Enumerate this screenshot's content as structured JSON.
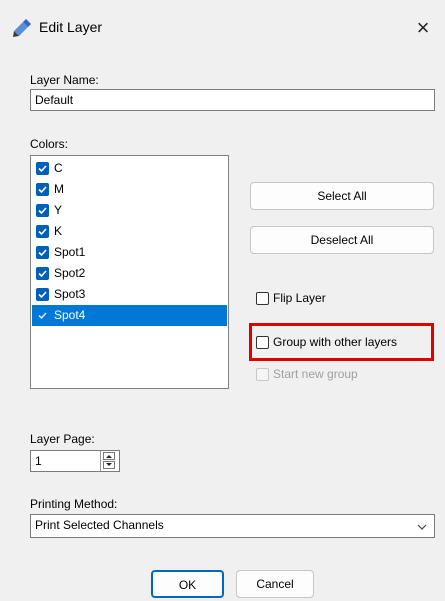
{
  "window": {
    "title": "Edit Layer",
    "close_label": "×",
    "icon": "edit-pencil-icon"
  },
  "layer_name": {
    "label": "Layer Name:",
    "value": "Default"
  },
  "colors": {
    "label": "Colors:",
    "items": [
      {
        "label": "C",
        "checked": true,
        "selected": false
      },
      {
        "label": "M",
        "checked": true,
        "selected": false
      },
      {
        "label": "Y",
        "checked": true,
        "selected": false
      },
      {
        "label": "K",
        "checked": true,
        "selected": false
      },
      {
        "label": "Spot1",
        "checked": true,
        "selected": false
      },
      {
        "label": "Spot2",
        "checked": true,
        "selected": false
      },
      {
        "label": "Spot3",
        "checked": true,
        "selected": false
      },
      {
        "label": "Spot4",
        "checked": true,
        "selected": true
      }
    ]
  },
  "buttons": {
    "select_all": "Select All",
    "deselect_all": "Deselect All",
    "ok": "OK",
    "cancel": "Cancel"
  },
  "options": {
    "flip_layer": {
      "label": "Flip Layer",
      "checked": false
    },
    "group_with_other": {
      "label": "Group with other layers",
      "checked": false
    },
    "start_new_group": {
      "label": "Start new group",
      "checked": false,
      "disabled": true
    }
  },
  "layer_page": {
    "label": "Layer Page:",
    "value": "1"
  },
  "printing_method": {
    "label": "Printing Method:",
    "selected": "Print Selected Channels"
  },
  "colors_theme": {
    "accent": "#0078d7",
    "highlight": "#e00000"
  }
}
